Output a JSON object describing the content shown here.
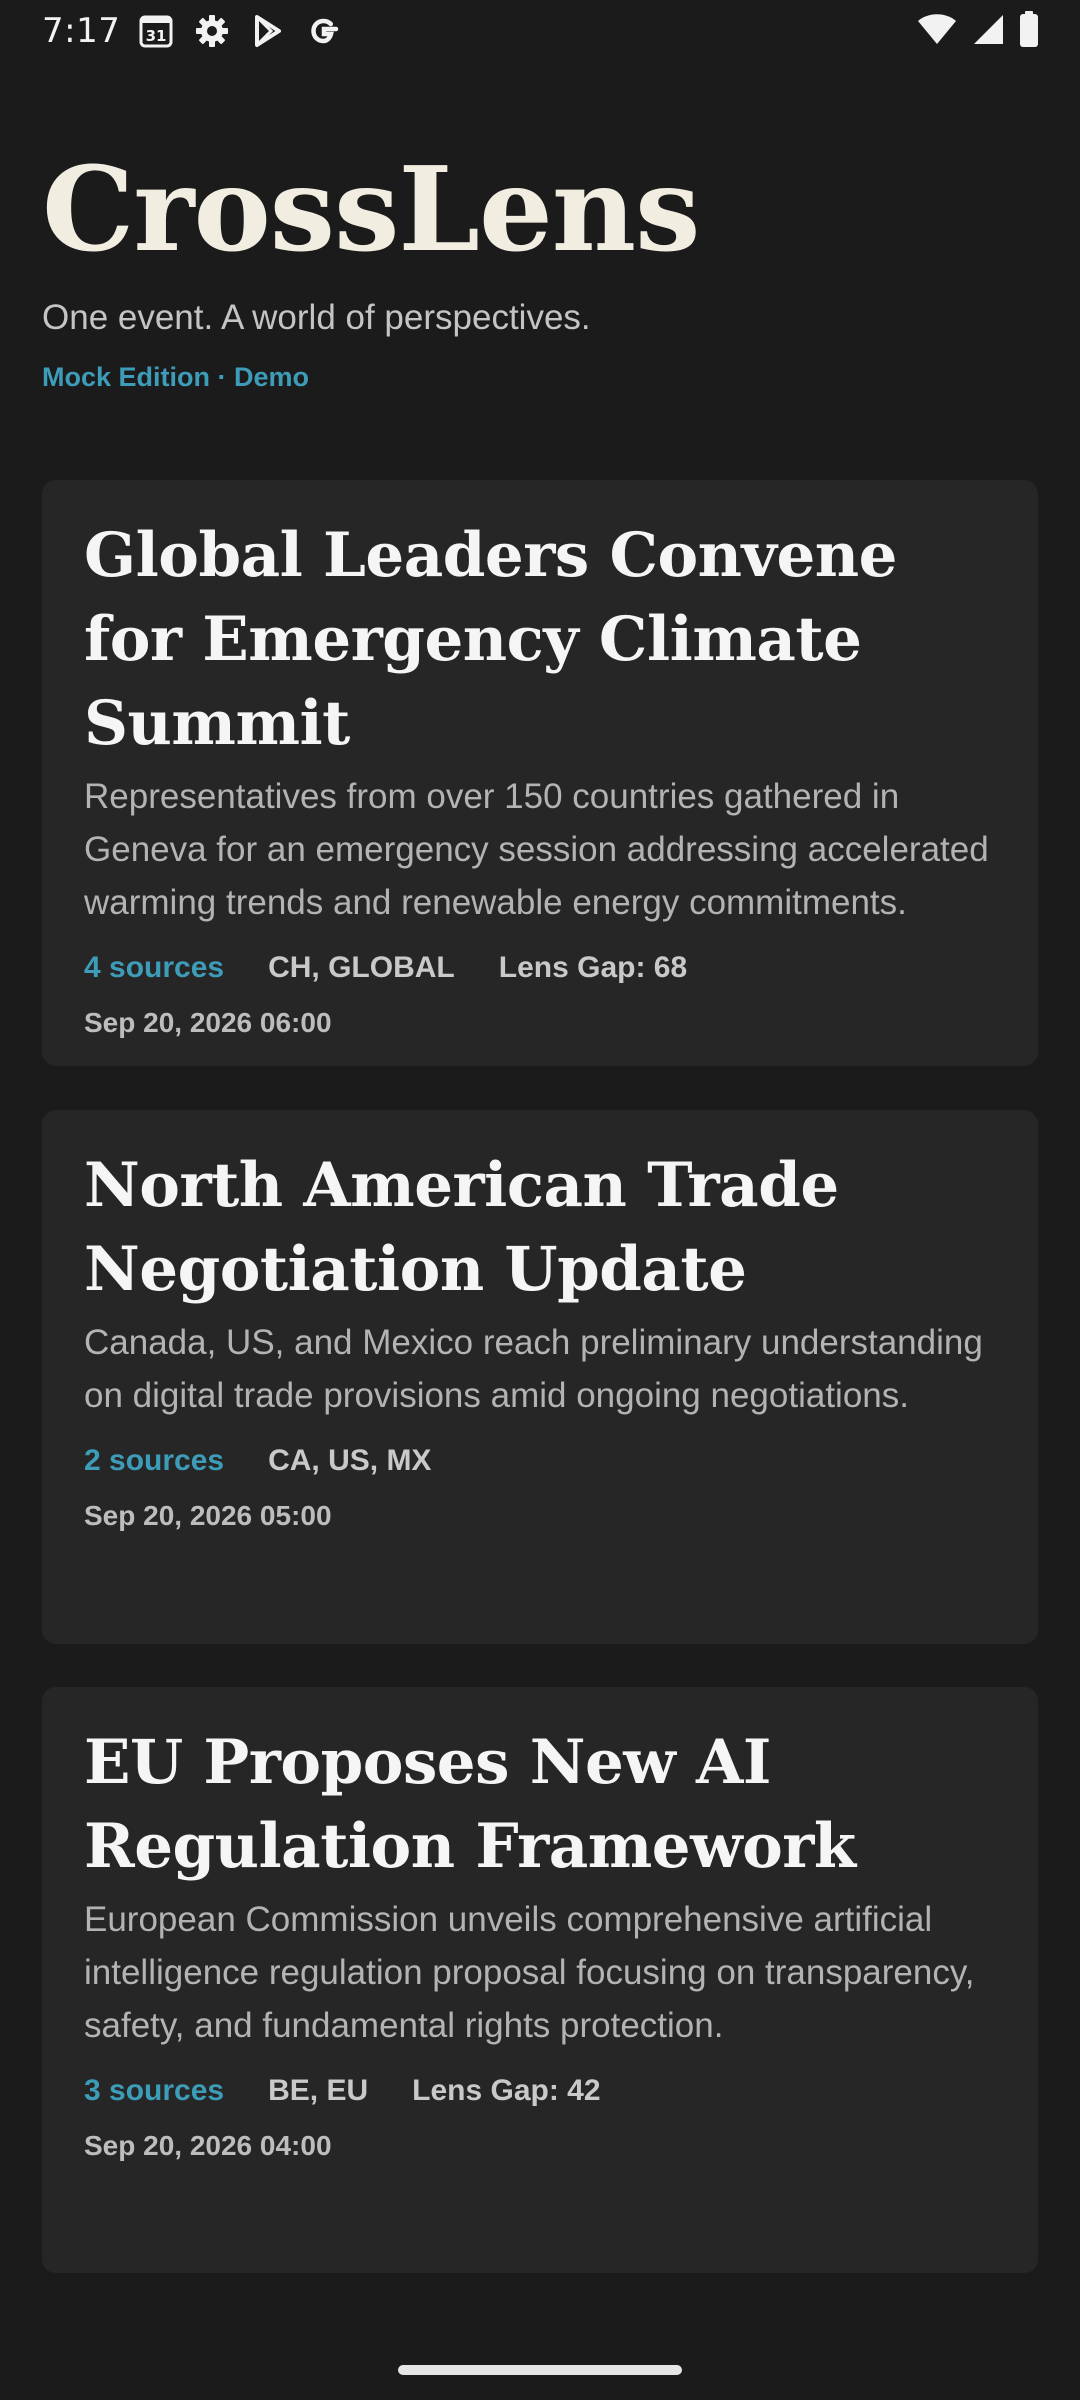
{
  "status_bar": {
    "time": "7:17",
    "calendar_day": "31",
    "icons_left": [
      "calendar-icon",
      "gear-icon",
      "play-store-icon",
      "google-icon"
    ],
    "icons_right": [
      "wifi-icon",
      "cellular-signal-icon",
      "battery-icon"
    ]
  },
  "header": {
    "title": "CrossLens",
    "tagline": "One event. A world of perspectives.",
    "edition": "Mock Edition · Demo"
  },
  "colors": {
    "background": "#1b1b1b",
    "card": "#262626",
    "accent": "#3d9cb8",
    "title_text": "#f2ede1"
  },
  "stories": [
    {
      "title": "Global Leaders Convene for Emergency Climate Summit",
      "summary": "Representatives from over 150 countries gathered in Geneva for an emergency session addressing accelerated warming trends and renewable energy commitments.",
      "sources": "4 sources",
      "regions": "CH, GLOBAL",
      "lens_gap": "Lens Gap: 68",
      "date": "Sep 20, 2026 06:00"
    },
    {
      "title": "North American Trade Negotiation Update",
      "summary": "Canada, US, and Mexico reach preliminary understanding on digital trade provisions amid ongoing negotiations.",
      "sources": "2 sources",
      "regions": "CA, US, MX",
      "lens_gap": "",
      "date": "Sep 20, 2026 05:00"
    },
    {
      "title": "EU Proposes New AI Regulation Framework",
      "summary": "European Commission unveils comprehensive artificial intelligence regulation proposal focusing on transparency, safety, and fundamental rights protection.",
      "sources": "3 sources",
      "regions": "BE, EU",
      "lens_gap": "Lens Gap: 42",
      "date": "Sep 20, 2026 04:00"
    }
  ]
}
